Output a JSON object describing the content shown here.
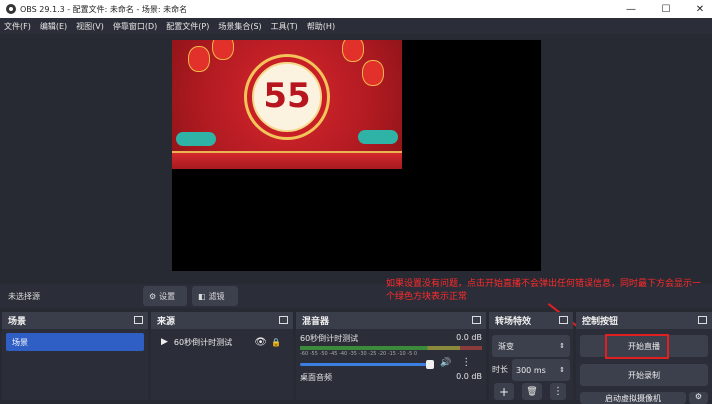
{
  "window": {
    "title": "OBS 29.1.3 - 配置文件: 未命名 - 场景: 未命名"
  },
  "menu": {
    "items": [
      "文件(F)",
      "编辑(E)",
      "视图(V)",
      "停靠窗口(D)",
      "配置文件(P)",
      "场景集合(S)",
      "工具(T)",
      "帮助(H)"
    ]
  },
  "preview": {
    "countdown_number": "55"
  },
  "source_bar": {
    "no_source_label": "未选择源",
    "settings_label": "设置",
    "filters_label": "滤镜"
  },
  "annotation": {
    "text": "如果设置没有问题，点击开始直播不会弹出任何错误信息，同时最下方会显示一个绿色方块表示正常"
  },
  "scenes": {
    "title": "场景",
    "items": [
      "场景"
    ]
  },
  "sources": {
    "title": "来源",
    "items": [
      "60秒倒计时测试"
    ]
  },
  "mixer": {
    "title": "混音器",
    "tracks": [
      {
        "name": "60秒倒计时测试",
        "level": "0.0 dB"
      },
      {
        "name": "桌面音频",
        "level": "0.0 dB"
      }
    ],
    "ticks": "-60 -55 -50 -45 -40 -35 -30 -25 -20 -15 -10 -5 0"
  },
  "transitions": {
    "title": "转场特效",
    "type": "渐变",
    "duration_label": "时长",
    "duration_value": "300 ms"
  },
  "controls": {
    "title": "控制按钮",
    "start_stream": "开始直播",
    "start_record": "开始录制",
    "virtual_cam": "启动虚拟摄像机"
  }
}
